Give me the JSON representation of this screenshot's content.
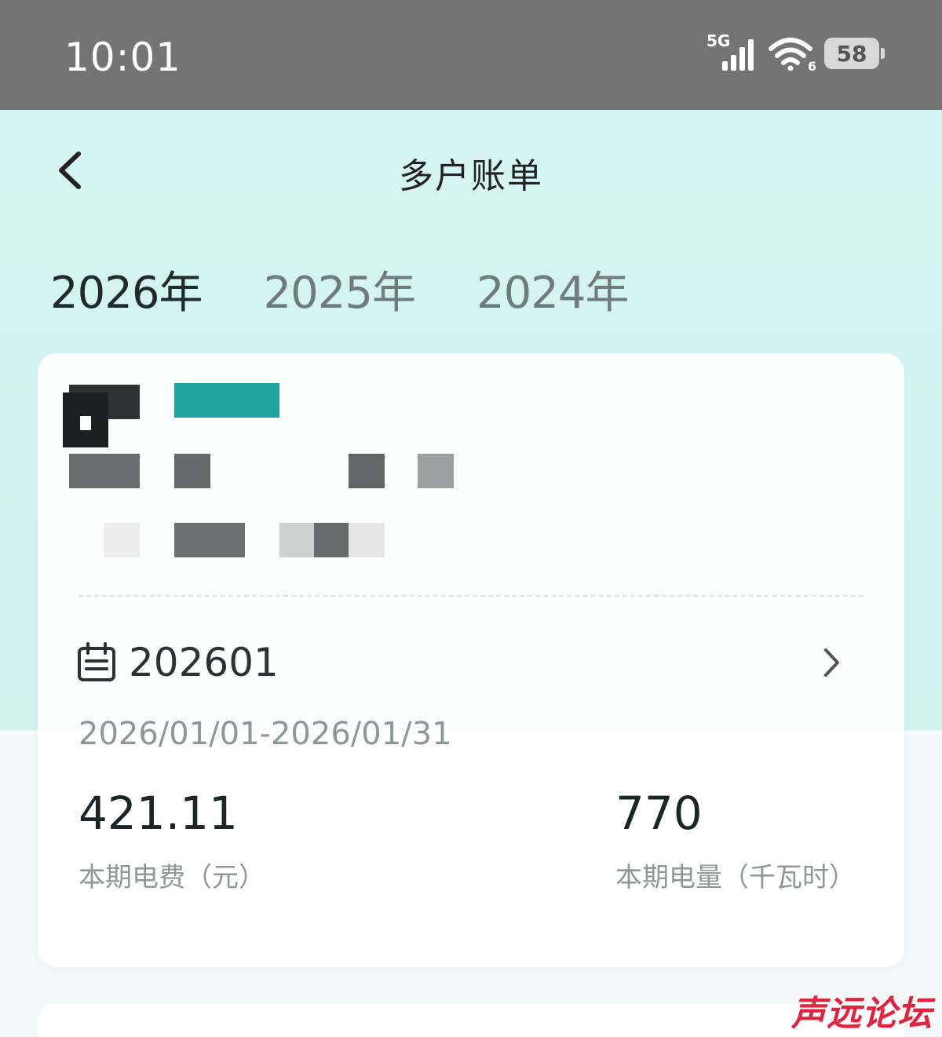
{
  "status_bar": {
    "time": "10:01",
    "network": "5G",
    "wifi_badge": "6",
    "battery": "58"
  },
  "nav": {
    "title": "多户账单",
    "back_icon": "chevron-left-icon"
  },
  "year_tabs": [
    {
      "label": "2026年",
      "active": true
    },
    {
      "label": "2025年",
      "active": false
    },
    {
      "label": "2024年",
      "active": false
    }
  ],
  "bill": {
    "period": "202601",
    "date_range": "2026/01/01-2026/01/31",
    "fee_value": "421.11",
    "fee_label": "本期电费（元）",
    "usage_value": "770",
    "usage_label": "本期电量（千瓦时）",
    "account_tag_color": "#22a49e"
  },
  "watermark": "声远论坛"
}
